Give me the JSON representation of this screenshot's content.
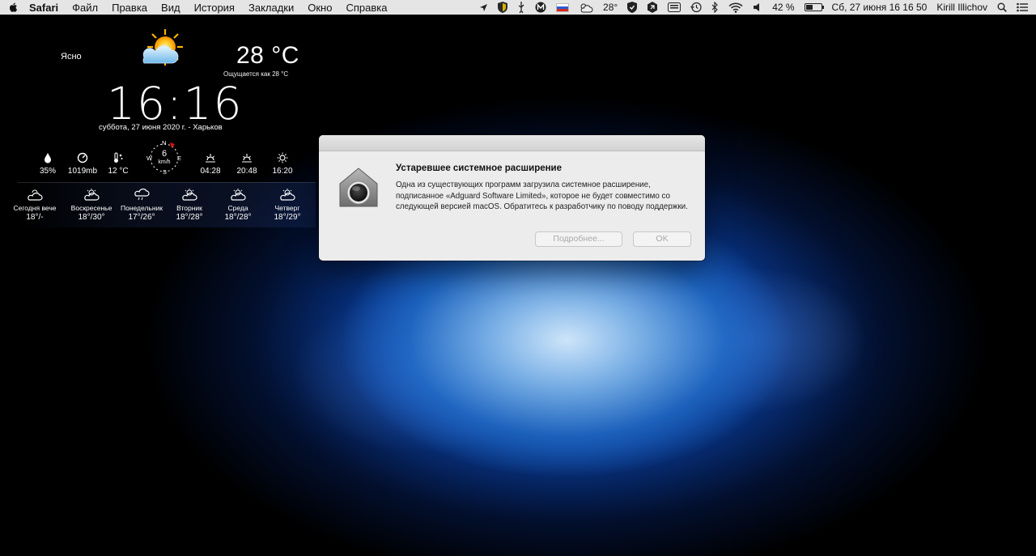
{
  "menubar": {
    "app_name": "Safari",
    "items": [
      "Файл",
      "Правка",
      "Вид",
      "История",
      "Закладки",
      "Окно",
      "Справка"
    ],
    "status": {
      "weather_temp": "28°",
      "battery_percent": "42 %",
      "battery_level": 0.42,
      "datetime": "Сб, 27 июня  16 16 50",
      "user": "Kirill Illichov"
    }
  },
  "weather": {
    "condition": "Ясно",
    "temperature": "28 °C",
    "feels_like": "Ощущается как  28 °C",
    "time": "16:16",
    "date_location": "суббота, 27 июня 2020 г. - Харьков",
    "stats": {
      "humidity": "35%",
      "pressure": "1019mb",
      "dew_point": "12 °C",
      "wind_speed": "6",
      "wind_unit": "km/h",
      "compass": {
        "n": "N",
        "e": "E",
        "s": "S",
        "w": "W"
      },
      "sunrise": "04:28",
      "sunset": "20:48",
      "daylight": "16:20"
    },
    "forecast": [
      {
        "day": "Сегодня вече",
        "temps": "18°/-"
      },
      {
        "day": "Воскресенье",
        "temps": "18°/30°"
      },
      {
        "day": "Понедельник",
        "temps": "17°/26°"
      },
      {
        "day": "Вторник",
        "temps": "18°/28°"
      },
      {
        "day": "Среда",
        "temps": "18°/28°"
      },
      {
        "day": "Четверг",
        "temps": "18°/29°"
      }
    ]
  },
  "dialog": {
    "title": "Устаревшее системное расширение",
    "body": "Одна из существующих программ загрузила системное расширение, подписанное «Adguard Software Limited», которое не будет совместимо со следующей версией macOS. Обратитесь к разработчику по поводу поддержки.",
    "details_button": "Подробнее...",
    "ok_button": "OK"
  }
}
